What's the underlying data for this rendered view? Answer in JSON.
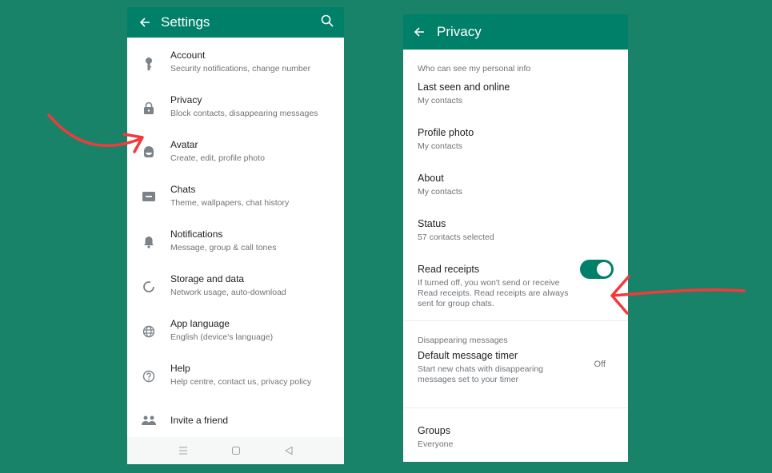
{
  "settings": {
    "title": "Settings",
    "items": [
      {
        "icon": "key-icon",
        "title": "Account",
        "desc": "Security notifications, change number"
      },
      {
        "icon": "lock-icon",
        "title": "Privacy",
        "desc": "Block contacts, disappearing messages"
      },
      {
        "icon": "avatar-icon",
        "title": "Avatar",
        "desc": "Create, edit, profile photo"
      },
      {
        "icon": "chat-icon",
        "title": "Chats",
        "desc": "Theme, wallpapers, chat history"
      },
      {
        "icon": "bell-icon",
        "title": "Notifications",
        "desc": "Message, group & call tones"
      },
      {
        "icon": "storage-icon",
        "title": "Storage and data",
        "desc": "Network usage, auto-download"
      },
      {
        "icon": "globe-icon",
        "title": "App language",
        "desc": "English (device's language)"
      },
      {
        "icon": "help-icon",
        "title": "Help",
        "desc": "Help centre, contact us, privacy policy"
      },
      {
        "icon": "people-icon",
        "title": "Invite a friend"
      }
    ]
  },
  "privacy": {
    "title": "Privacy",
    "section1": "Who can see my personal info",
    "items": [
      {
        "title": "Last seen and online",
        "desc": "My contacts"
      },
      {
        "title": "Profile photo",
        "desc": "My contacts"
      },
      {
        "title": "About",
        "desc": "My contacts"
      },
      {
        "title": "Status",
        "desc": "57 contacts selected"
      }
    ],
    "read_receipts": {
      "title": "Read receipts",
      "desc": "If turned off, you won't send or receive Read receipts. Read receipts are always sent for group chats.",
      "enabled": true
    },
    "section2": "Disappearing messages",
    "timer": {
      "title": "Default message timer",
      "desc": "Start new chats with disappearing messages set to your timer",
      "value": "Off"
    },
    "groups": {
      "title": "Groups",
      "desc": "Everyone"
    }
  },
  "colors": {
    "brand": "#008069",
    "background": "#19836a",
    "annotation": "#f23a3a"
  }
}
